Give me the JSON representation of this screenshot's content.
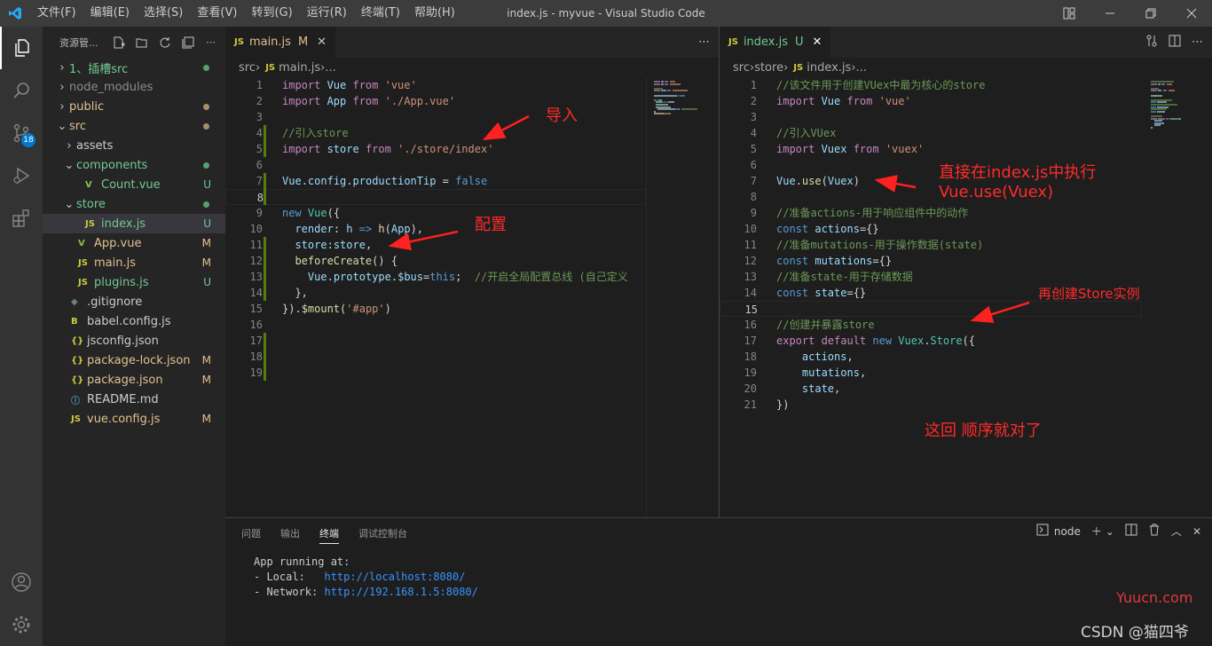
{
  "titlebar": {
    "menu": [
      "文件(F)",
      "编辑(E)",
      "选择(S)",
      "查看(V)",
      "转到(G)",
      "运行(R)",
      "终端(T)",
      "帮助(H)"
    ],
    "title": "index.js - myvue - Visual Studio Code"
  },
  "activity": {
    "scm_badge": "18"
  },
  "sidebar": {
    "title": "资源管...",
    "items": [
      {
        "label": "1、插槽src",
        "chev": "›",
        "color": "#73c991",
        "deco": "dot"
      },
      {
        "label": "node_modules",
        "chev": "›",
        "color": "#8c8c8c"
      },
      {
        "label": "public",
        "chev": "›",
        "color": "#e2c08d",
        "deco": "dot"
      },
      {
        "label": "src",
        "chev": "⌄",
        "color": "#e2c08d",
        "deco": "dot"
      },
      {
        "label": "assets",
        "chev": "›",
        "color": "#cccccc"
      },
      {
        "label": "components",
        "chev": "⌄",
        "color": "#73c991",
        "deco": "dot"
      },
      {
        "label": "Count.vue",
        "icon": "V",
        "color": "#73c991",
        "deco": "U"
      },
      {
        "label": "store",
        "chev": "⌄",
        "color": "#73c991",
        "deco": "dot"
      },
      {
        "label": "index.js",
        "icon": "JS",
        "color": "#73c991",
        "deco": "U"
      },
      {
        "label": "App.vue",
        "icon": "V",
        "color": "#e2c08d",
        "deco": "M"
      },
      {
        "label": "main.js",
        "icon": "JS",
        "color": "#e2c08d",
        "deco": "M"
      },
      {
        "label": "plugins.js",
        "icon": "JS",
        "color": "#73c991",
        "deco": "U"
      },
      {
        "label": ".gitignore",
        "icon": "◆",
        "color": "#cccccc"
      },
      {
        "label": "babel.config.js",
        "icon": "B",
        "color": "#cccccc"
      },
      {
        "label": "jsconfig.json",
        "icon": "{}",
        "color": "#cccccc"
      },
      {
        "label": "package-lock.json",
        "icon": "{}",
        "color": "#e2c08d",
        "deco": "M"
      },
      {
        "label": "package.json",
        "icon": "{}",
        "color": "#e2c08d",
        "deco": "M"
      },
      {
        "label": "README.md",
        "icon": "ⓘ",
        "color": "#cccccc"
      },
      {
        "label": "vue.config.js",
        "icon": "JS",
        "color": "#e2c08d",
        "deco": "M"
      }
    ]
  },
  "left_editor": {
    "tab_name": "main.js",
    "tab_status": "M",
    "breadcrumb": [
      "src",
      "main.js",
      "..."
    ],
    "lines": [
      [
        [
          "kw",
          "import "
        ],
        [
          "var",
          "Vue "
        ],
        [
          "kw",
          "from "
        ],
        [
          "str",
          "'vue'"
        ]
      ],
      [
        [
          "kw",
          "import "
        ],
        [
          "var",
          "App "
        ],
        [
          "kw",
          "from "
        ],
        [
          "str",
          "'./App.vue'"
        ]
      ],
      [],
      [
        [
          "com",
          "//引入store"
        ]
      ],
      [
        [
          "kw",
          "import "
        ],
        [
          "var",
          "store "
        ],
        [
          "kw",
          "from "
        ],
        [
          "str",
          "'./store/index'"
        ]
      ],
      [],
      [
        [
          "var",
          "Vue"
        ],
        [
          "pl",
          "."
        ],
        [
          "var",
          "config"
        ],
        [
          "pl",
          "."
        ],
        [
          "var",
          "productionTip "
        ],
        [
          "pl",
          "= "
        ],
        [
          "kw2",
          "false"
        ]
      ],
      [],
      [
        [
          "kw2",
          "new "
        ],
        [
          "cls",
          "Vue"
        ],
        [
          "pl",
          "({"
        ]
      ],
      [
        [
          "pl",
          "  "
        ],
        [
          "var",
          "render"
        ],
        [
          "pl",
          ": "
        ],
        [
          "var",
          "h "
        ],
        [
          "kw2",
          "=> "
        ],
        [
          "fn",
          "h"
        ],
        [
          "pl",
          "("
        ],
        [
          "var",
          "App"
        ],
        [
          "pl",
          "),"
        ]
      ],
      [
        [
          "pl",
          "  "
        ],
        [
          "var",
          "store"
        ],
        [
          "pl",
          ":"
        ],
        [
          "var",
          "store"
        ],
        [
          "pl",
          ","
        ]
      ],
      [
        [
          "pl",
          "  "
        ],
        [
          "fn",
          "beforeCreate"
        ],
        [
          "pl",
          "() {"
        ]
      ],
      [
        [
          "pl",
          "    "
        ],
        [
          "var",
          "Vue"
        ],
        [
          "pl",
          "."
        ],
        [
          "var",
          "prototype"
        ],
        [
          "pl",
          "."
        ],
        [
          "var",
          "$bus"
        ],
        [
          "pl",
          "="
        ],
        [
          "kw2",
          "this"
        ],
        [
          "pl",
          ";  "
        ],
        [
          "com",
          "//开启全局配置总线 (自己定义"
        ]
      ],
      [
        [
          "pl",
          "  },"
        ]
      ],
      [
        [
          "pl",
          "})."
        ],
        [
          "fn",
          "$mount"
        ],
        [
          "pl",
          "("
        ],
        [
          "str",
          "'#app'"
        ],
        [
          "pl",
          ")"
        ]
      ],
      [],
      [],
      [],
      []
    ]
  },
  "right_editor": {
    "tab_name": "index.js",
    "tab_status": "U",
    "breadcrumb": [
      "src",
      "store",
      "index.js",
      "..."
    ],
    "lines": [
      [
        [
          "com",
          "//该文件用于创建VUex中最为核心的store"
        ]
      ],
      [
        [
          "kw",
          "import "
        ],
        [
          "var",
          "Vue "
        ],
        [
          "kw",
          "from "
        ],
        [
          "str",
          "'vue'"
        ]
      ],
      [],
      [
        [
          "com",
          "//引入VUex"
        ]
      ],
      [
        [
          "kw",
          "import "
        ],
        [
          "var",
          "Vuex "
        ],
        [
          "kw",
          "from "
        ],
        [
          "str",
          "'vuex'"
        ]
      ],
      [],
      [
        [
          "var",
          "Vue"
        ],
        [
          "pl",
          "."
        ],
        [
          "fn",
          "use"
        ],
        [
          "pl",
          "("
        ],
        [
          "var",
          "Vuex"
        ],
        [
          "pl",
          ")"
        ]
      ],
      [],
      [
        [
          "com",
          "//准备actions-用于响应组件中的动作"
        ]
      ],
      [
        [
          "kw2",
          "const "
        ],
        [
          "var",
          "actions"
        ],
        [
          "pl",
          "={}"
        ]
      ],
      [
        [
          "com",
          "//准备mutations-用于操作数据(state)"
        ]
      ],
      [
        [
          "kw2",
          "const "
        ],
        [
          "var",
          "mutations"
        ],
        [
          "pl",
          "={}"
        ]
      ],
      [
        [
          "com",
          "//准备state-用于存储数据"
        ]
      ],
      [
        [
          "kw2",
          "const "
        ],
        [
          "var",
          "state"
        ],
        [
          "pl",
          "={}"
        ]
      ],
      [],
      [
        [
          "com",
          "//创建并暴露store"
        ]
      ],
      [
        [
          "kw",
          "export "
        ],
        [
          "kw",
          "default "
        ],
        [
          "kw2",
          "new "
        ],
        [
          "cls",
          "Vuex"
        ],
        [
          "pl",
          "."
        ],
        [
          "cls",
          "Store"
        ],
        [
          "pl",
          "({"
        ]
      ],
      [
        [
          "pl",
          "    "
        ],
        [
          "var",
          "actions"
        ],
        [
          "pl",
          ","
        ]
      ],
      [
        [
          "pl",
          "    "
        ],
        [
          "var",
          "mutations"
        ],
        [
          "pl",
          ","
        ]
      ],
      [
        [
          "pl",
          "    "
        ],
        [
          "var",
          "state"
        ],
        [
          "pl",
          ","
        ]
      ],
      [
        [
          "pl",
          "})"
        ]
      ]
    ]
  },
  "annotations": {
    "import": "导入",
    "config": "配置",
    "exec_line1": "直接在index.js中执行",
    "exec_line2": "Vue.use(Vuex)",
    "store": "再创建Store实例",
    "order": "这回 顺序就对了"
  },
  "panel": {
    "tabs": [
      "问题",
      "输出",
      "终端",
      "调试控制台"
    ],
    "active_tab": "终端",
    "terminal_name": "node",
    "terminal": {
      "line1": "App running at:",
      "local_label": "- Local:   ",
      "local_url": "http://localhost:8080/",
      "network_label": "- Network: ",
      "network_url": "http://192.168.1.5:8080/"
    }
  },
  "watermarks": {
    "yuucn": "Yuucn.com",
    "csdn": "CSDN @猫四爷"
  }
}
